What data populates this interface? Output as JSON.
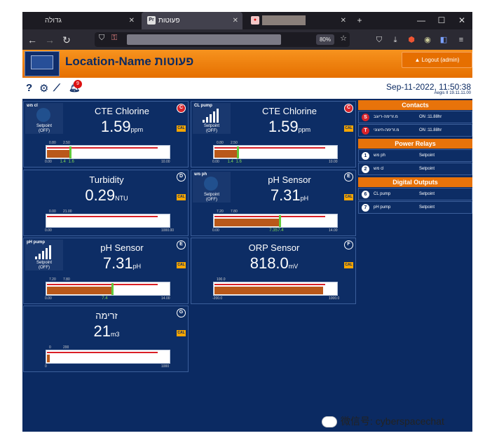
{
  "browser": {
    "tabs": [
      {
        "label": "גדולה",
        "active": false
      },
      {
        "label": "פעוטות",
        "active": true
      },
      {
        "label": "",
        "active": false
      }
    ],
    "zoom": "80%"
  },
  "app": {
    "title": "Location-Name פעוטות",
    "logout_label": "Logout (admin)",
    "notification_count": "9",
    "datetime": "Sep-11-2022, 11:50:38",
    "version": "Aegis II 19.11.11.00"
  },
  "tiles": [
    {
      "title": "CTE Chlorine",
      "value": "1.59",
      "unit": "ppm",
      "channel": "C",
      "channel_color": "#d8232a",
      "cal": "CAL",
      "mini": {
        "title": "מש cl",
        "type": "setpoint",
        "setpoint": "Setpoint",
        "state": "(OFF)"
      },
      "gauge": {
        "level": 0.18,
        "band": [
          0.0,
          0.0
        ],
        "marker": 0.19,
        "labels": [
          "0.80",
          "2.50"
        ],
        "bottom": [
          "0.00",
          "1.4",
          "1.6",
          "10.00"
        ]
      }
    },
    {
      "title": "CTE Chlorine",
      "value": "1.59",
      "unit": "ppm",
      "channel": "C",
      "channel_color": "#d8232a",
      "cal": "CAL",
      "mini": {
        "title": "CL pump",
        "type": "pump",
        "setpoint": "Setpoint",
        "state": "(OFF)"
      },
      "gauge": {
        "level": 0.18,
        "band": [
          0.0,
          0.0
        ],
        "marker": 0.19,
        "labels": [
          "0.80",
          "2.50"
        ],
        "bottom": [
          "0.00",
          "1.4",
          "1.6",
          "10.00"
        ]
      }
    },
    {
      "title": "Turbidity",
      "value": "0.29",
      "unit": "NTU",
      "channel": "D",
      "channel_color": "",
      "cal": "CAL",
      "mini": null,
      "gauge": {
        "level": 0.0,
        "marker": null,
        "labels": [
          "0.00",
          "21.00"
        ],
        "bottom": [
          "0.00",
          "1000.00"
        ]
      }
    },
    {
      "title": "pH Sensor",
      "value": "7.31",
      "unit": "pH",
      "channel": "E",
      "channel_color": "",
      "cal": "CAL",
      "mini": {
        "title": "מש ph",
        "type": "setpoint",
        "setpoint": "Setpoint",
        "state": "(OFF)"
      },
      "gauge": {
        "level": 0.52,
        "marker": 0.53,
        "labels": [
          "7.20",
          "7.80"
        ],
        "bottom": [
          "0.00",
          "7.35",
          "7.4",
          "14.00"
        ]
      }
    },
    {
      "title": "pH Sensor",
      "value": "7.31",
      "unit": "pH",
      "channel": "E",
      "channel_color": "",
      "cal": "CAL",
      "mini": {
        "title": "pH pump",
        "type": "pump",
        "setpoint": "Setpoint",
        "state": "(OFF)"
      },
      "gauge": {
        "level": 0.52,
        "marker": 0.53,
        "labels": [
          "7.20",
          "7.80"
        ],
        "bottom": [
          "0.00",
          "7.4",
          "14.00"
        ]
      }
    },
    {
      "title": "ORP Sensor",
      "value": "818.0",
      "unit": "mV",
      "channel": "F",
      "channel_color": "",
      "cal": "CAL",
      "mini": null,
      "gauge": {
        "level": 0.88,
        "marker": null,
        "labels": [
          "100.0"
        ],
        "bottom": [
          "-200.0",
          "1000.0"
        ]
      }
    },
    {
      "title": "זרימה",
      "value": "21",
      "unit": "m3",
      "channel": "G",
      "channel_color": "",
      "cal": "CAL",
      "mini": null,
      "gauge": {
        "level": 0.02,
        "marker": null,
        "labels": [
          "0",
          "200"
        ],
        "bottom": [
          "0",
          "1000"
        ]
      }
    }
  ],
  "panel": {
    "contacts_title": "Contacts",
    "contacts": [
      {
        "num": "S",
        "name": "מ.זרימה-ריוגב",
        "value": "ON :11.88hr"
      },
      {
        "num": "T",
        "name": "מ.זרימה-חיצוני",
        "value": "ON :11.88hr"
      }
    ],
    "relays_title": "Power Relays",
    "relays": [
      {
        "num": "1",
        "name": "מש ph",
        "value": "Setpoint"
      },
      {
        "num": "2",
        "name": "מש cl",
        "value": "Setpoint"
      }
    ],
    "outputs_title": "Digital Outputs",
    "outputs": [
      {
        "num": "6",
        "name": "CL pump",
        "value": "Setpoint"
      },
      {
        "num": "7",
        "name": "pH pump",
        "value": "Setpoint"
      }
    ]
  },
  "watermark": "微信号: cyberspacechat"
}
